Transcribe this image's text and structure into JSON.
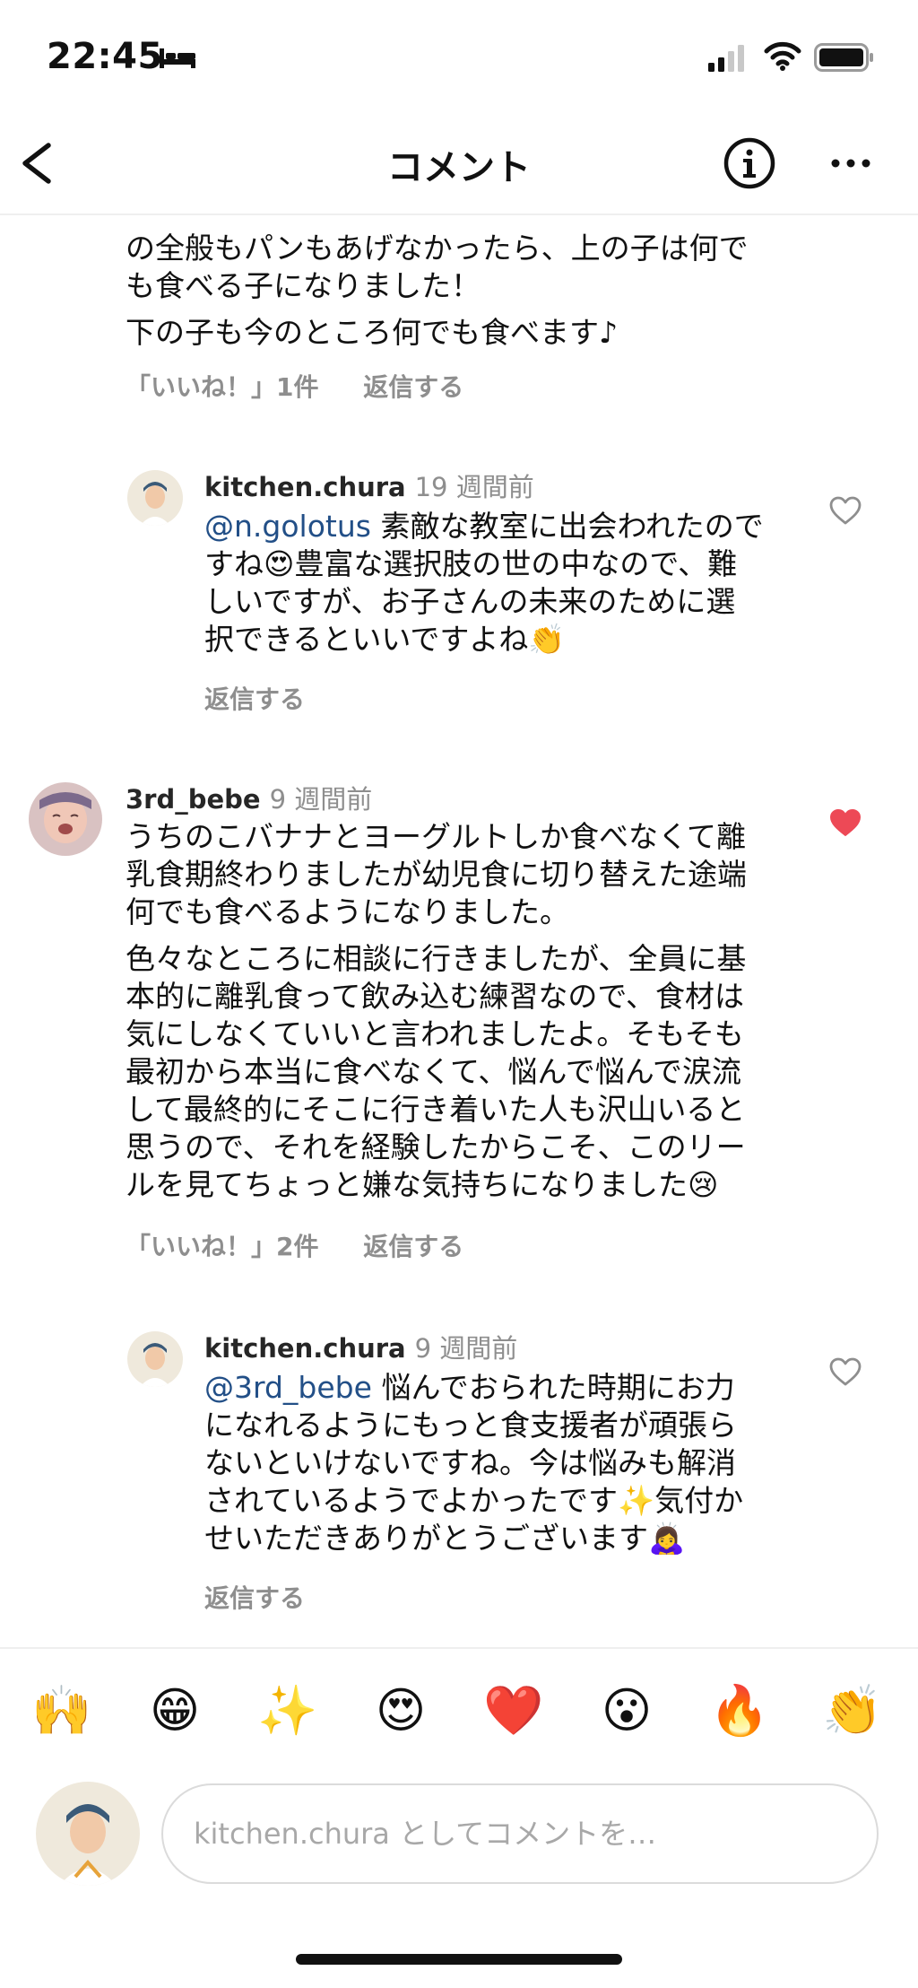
{
  "status_bar": {
    "time": "22:45"
  },
  "header": {
    "title": "コメント"
  },
  "comments": [
    {
      "lines": [
        "の全般もパンもあげなかったら、上の子は何で",
        "も食べる子になりました！"
      ],
      "lines2": [
        "下の子も今のところ何でも食べます♪"
      ],
      "likes_label": "「いいね！」1件",
      "reply_label": "返信する"
    },
    {
      "username": "kitchen.chura",
      "time_ago": "19 週間前",
      "mention": "@n.golotus",
      "lines": [
        "素敵な教室に出会われたので",
        "すね😍豊富な選択肢の世の中なので、難",
        "しいですが、お子さんの未来のために選",
        "択できるといいですよね👏"
      ],
      "reply_label": "返信する",
      "liked": false
    },
    {
      "username": "3rd_bebe",
      "time_ago": "9 週間前",
      "lines": [
        "うちのこバナナとヨーグルトしか食べなくて離",
        "乳食期終わりましたが幼児食に切り替えた途端",
        "何でも食べるようになりました。"
      ],
      "lines2": [
        "色々なところに相談に行きましたが、全員に基",
        "本的に離乳食って飲み込む練習なので、食材は",
        "気にしなくていいと言われましたよ。そもそも",
        "最初から本当に食べなくて、悩んで悩んで涙流",
        "して最終的にそこに行き着いた人も沢山いると",
        "思うので、それを経験したからこそ、このリー",
        "ルを見てちょっと嫌な気持ちになりました😢"
      ],
      "likes_label": "「いいね！」2件",
      "reply_label": "返信する",
      "liked": true
    },
    {
      "username": "kitchen.chura",
      "time_ago": "9 週間前",
      "mention": "@3rd_bebe",
      "lines": [
        "悩んでおられた時期にお力",
        "になれるようにもっと食支援者が頑張ら",
        "ないといけないですね。今は悩みも解消",
        "されているようでよかったです✨気付か",
        "せいただきありがとうございます🙇‍♀️"
      ],
      "reply_label": "返信する",
      "liked": false
    }
  ],
  "emoji_bar": [
    "🙌",
    "😁",
    "✨",
    "😍",
    "❤️",
    "😮",
    "🔥",
    "👏"
  ],
  "composer": {
    "placeholder": "kitchen.chura としてコメントを…"
  },
  "colors": {
    "mention": "#224f87",
    "liked_heart": "#ed4956",
    "muted": "#8e8e8e"
  },
  "icons": [
    "bed-icon",
    "signal-icon",
    "wifi-icon",
    "battery-icon",
    "back-arrow-icon",
    "info-icon",
    "more-icon",
    "heart-icon"
  ]
}
